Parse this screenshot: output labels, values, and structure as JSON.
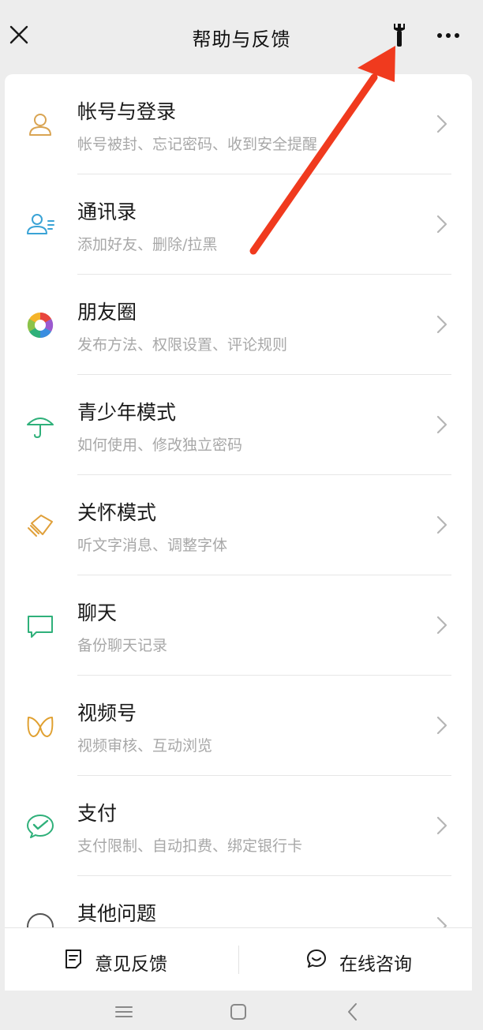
{
  "header": {
    "title": "帮助与反馈"
  },
  "menu": [
    {
      "title": "帐号与登录",
      "subtitle": "帐号被封、忘记密码、收到安全提醒",
      "icon": "user-icon",
      "color": "#d9a452"
    },
    {
      "title": "通讯录",
      "subtitle": "添加好友、删除/拉黑",
      "icon": "contacts-icon",
      "color": "#3aa3d6"
    },
    {
      "title": "朋友圈",
      "subtitle": "发布方法、权限设置、评论规则",
      "icon": "moments-icon",
      "color": "#e0a030"
    },
    {
      "title": "青少年模式",
      "subtitle": "如何使用、修改独立密码",
      "icon": "umbrella-icon",
      "color": "#2fb07a"
    },
    {
      "title": "关怀模式",
      "subtitle": "听文字消息、调整字体",
      "icon": "care-icon",
      "color": "#e0a03a"
    },
    {
      "title": "聊天",
      "subtitle": "备份聊天记录",
      "icon": "chat-icon",
      "color": "#2fb07a"
    },
    {
      "title": "视频号",
      "subtitle": "视频审核、互动浏览",
      "icon": "channels-icon",
      "color": "#e0a030"
    },
    {
      "title": "支付",
      "subtitle": "支付限制、自动扣费、绑定银行卡",
      "icon": "pay-icon",
      "color": "#2fb07a"
    },
    {
      "title": "其他问题",
      "subtitle": "",
      "icon": "other-icon",
      "color": "#555555"
    }
  ],
  "bottom": {
    "feedback_label": "意见反馈",
    "consult_label": "在线咨询"
  },
  "colors": {
    "background": "#ededed",
    "card": "#ffffff",
    "annotation_arrow": "#f03a1e"
  }
}
